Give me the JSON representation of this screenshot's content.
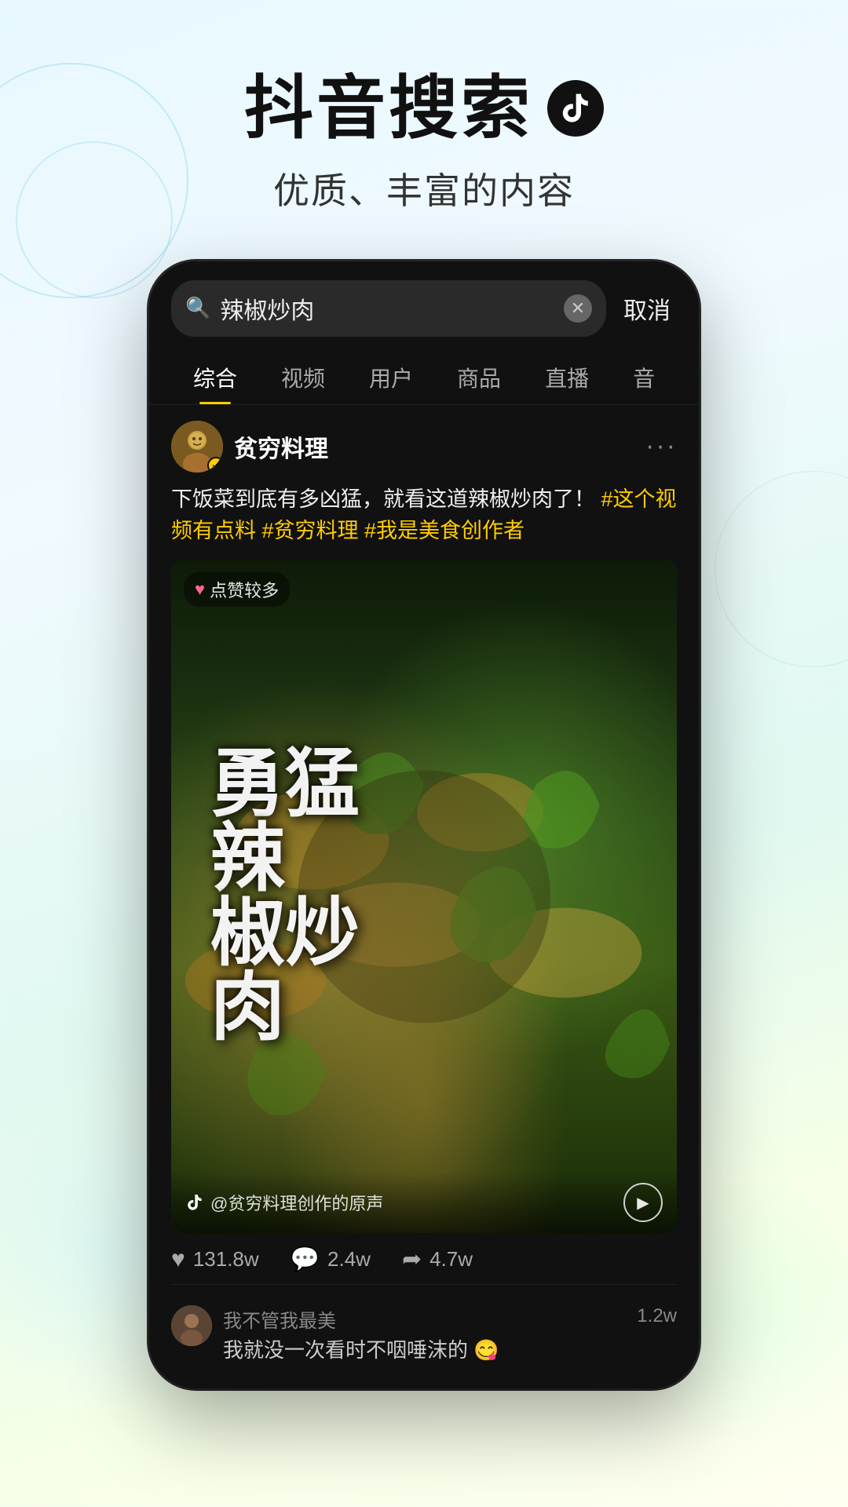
{
  "header": {
    "title": "抖音搜索",
    "tiktok_icon_label": "tiktok-logo",
    "subtitle": "优质、丰富的内容"
  },
  "phone": {
    "search": {
      "placeholder": "辣椒炒肉",
      "cancel_label": "取消"
    },
    "tabs": [
      {
        "label": "综合",
        "active": true
      },
      {
        "label": "视频",
        "active": false
      },
      {
        "label": "用户",
        "active": false
      },
      {
        "label": "商品",
        "active": false
      },
      {
        "label": "直播",
        "active": false
      },
      {
        "label": "音",
        "active": false
      }
    ],
    "post": {
      "username": "贫穷料理",
      "verified": true,
      "text_plain": "下饭菜到底有多凶猛，就看这道辣椒炒肉了！",
      "tags": "#这个视频有点料 #贫穷料理 #我是美食创作者",
      "video_badge": "点赞较多",
      "video_chinese_lines": [
        "勇",
        "猛",
        "辣",
        "椒",
        "炒",
        "肉"
      ],
      "video_title_text": "勇猛\n辣\n椒炒\n肉",
      "video_source": "@贫穷料理创作的原声",
      "engagement": {
        "likes": "131.8w",
        "comments": "2.4w",
        "shares": "4.7w"
      }
    },
    "comments": [
      {
        "username": "我不管我最美",
        "text": "我就没一次看时不咽唾沫的",
        "emoji": "😋",
        "count": "1.2w"
      }
    ]
  },
  "icons": {
    "search": "🔍",
    "clear": "✕",
    "heart": "♡",
    "heart_filled": "♥",
    "comment": "💬",
    "share": "➦",
    "play": "▶",
    "more": "···",
    "tiktok_note": "♪"
  }
}
